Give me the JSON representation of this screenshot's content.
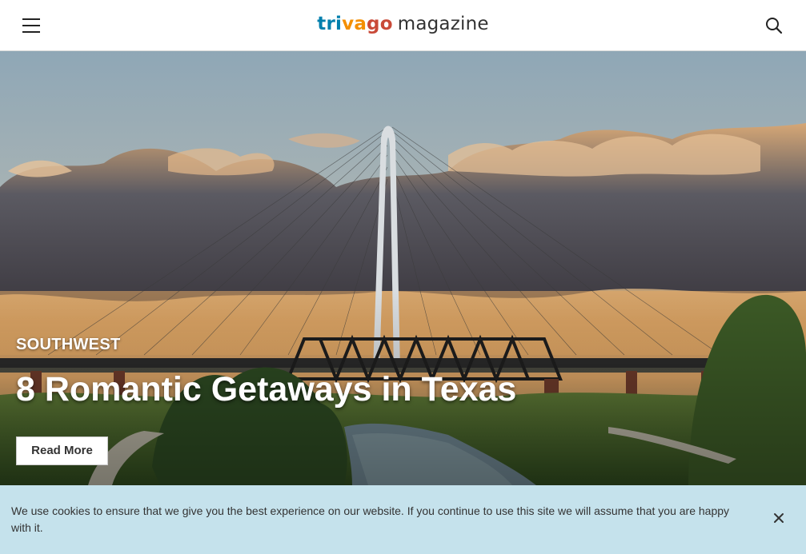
{
  "header": {
    "logo_parts": [
      "tri",
      "va",
      "go"
    ],
    "logo_sub": "magazine",
    "logo_colors": [
      "#007fad",
      "#f48f00",
      "#c94a38"
    ],
    "menu_icon": "hamburger-icon",
    "search_icon": "search-icon"
  },
  "hero": {
    "category": "SOUTHWEST",
    "title": "8 Romantic Getaways in Texas",
    "button_label": "Read More"
  },
  "cookie_banner": {
    "text": "We use cookies to ensure that we give you the best experience on our website. If you continue to use this site we will assume that you are happy with it.",
    "close_icon": "close-icon",
    "background": "#c5e2ec"
  }
}
